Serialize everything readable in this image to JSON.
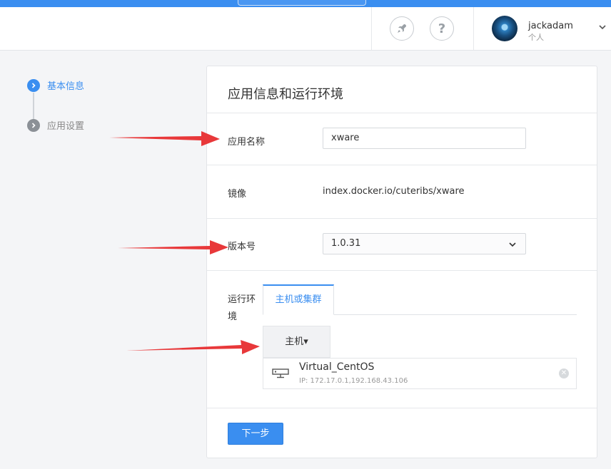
{
  "header": {
    "user": {
      "name": "jackadam",
      "type": "个人"
    },
    "icons": {
      "rocket": "rocket-icon",
      "help": "help-icon",
      "help_glyph": "?",
      "dropdown": "chevron-down-icon"
    }
  },
  "steps": [
    {
      "label": "基本信息",
      "state": "active"
    },
    {
      "label": "应用设置",
      "state": "inactive"
    }
  ],
  "form": {
    "title": "应用信息和运行环境",
    "app_name": {
      "label": "应用名称",
      "value": "xware"
    },
    "image": {
      "label": "镜像",
      "value": "index.docker.io/cuteribs/xware"
    },
    "version": {
      "label": "版本号",
      "value": "1.0.31"
    },
    "runtime": {
      "label_line1": "运行环",
      "label_line2": "境",
      "tab": "主机或集群",
      "host_button": "主机▾",
      "host": {
        "name": "Virtual_CentOS",
        "ip": "IP: 172.17.0.1,192.168.43.106"
      }
    },
    "next_button": "下一步"
  },
  "colors": {
    "accent": "#3a8ef0",
    "annotation_arrow": "#e8383a"
  }
}
